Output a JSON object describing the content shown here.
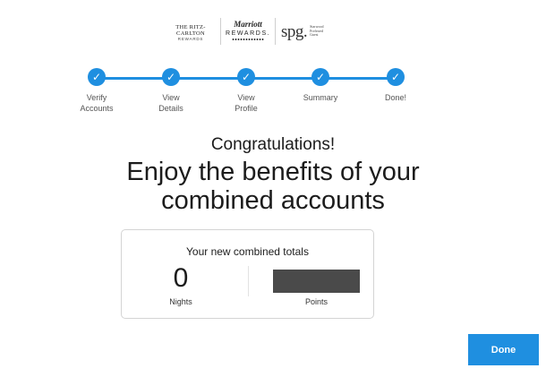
{
  "logos": {
    "ritz_carlton": {
      "line1": "THE RITZ-CARLTON",
      "line2": "REWARDS"
    },
    "marriott": {
      "line1": "Marriott",
      "line2": "REWARDS."
    },
    "spg": {
      "mark": "spg.",
      "sub": "Starwood Preferred Guest"
    }
  },
  "stepper": {
    "steps": [
      {
        "label": "Verify\nAccounts",
        "state": "complete"
      },
      {
        "label": "View\nDetails",
        "state": "complete"
      },
      {
        "label": "View\nProfile",
        "state": "complete"
      },
      {
        "label": "Summary",
        "state": "complete"
      },
      {
        "label": "Done!",
        "state": "complete"
      }
    ],
    "check_icon": "checkmark-icon",
    "accent_color": "#1f8fe0"
  },
  "main": {
    "congrats": "Congratulations!",
    "headline": "Enjoy the benefits of your combined accounts"
  },
  "totals": {
    "title": "Your new combined totals",
    "nights_value": "0",
    "nights_label": "Nights",
    "points_label": "Points",
    "points_value_redacted": true
  },
  "actions": {
    "done_label": "Done"
  }
}
